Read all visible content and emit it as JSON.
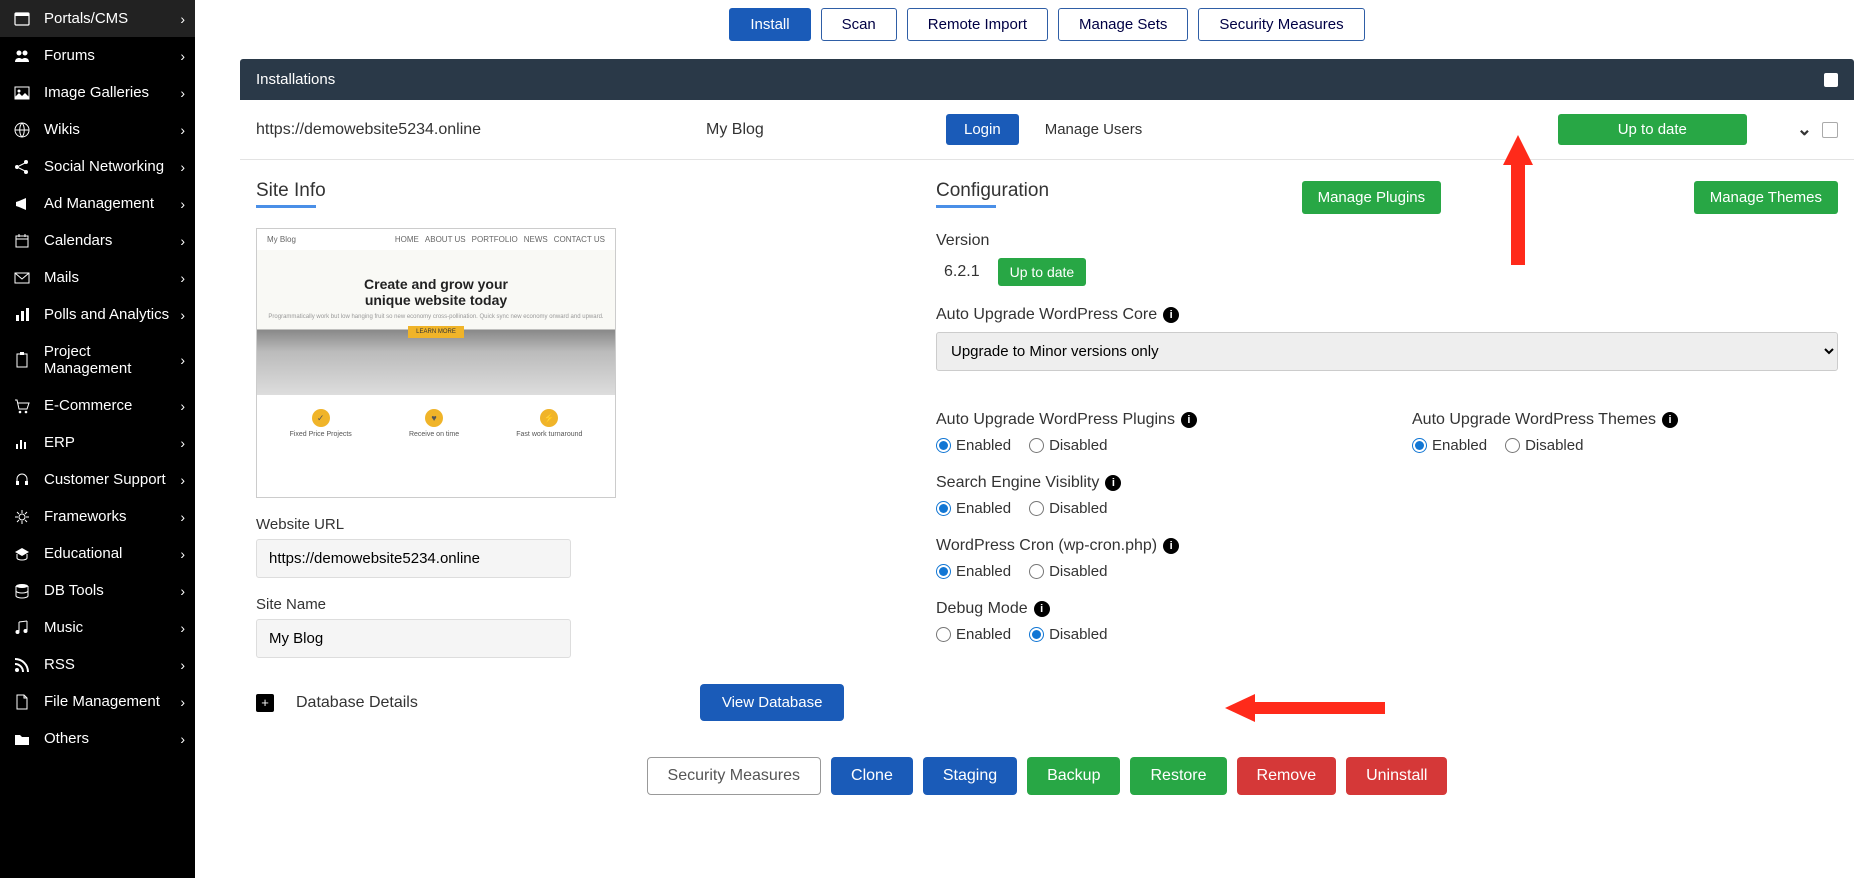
{
  "sidebar": {
    "items": [
      {
        "label": "Portals/CMS"
      },
      {
        "label": "Forums"
      },
      {
        "label": "Image Galleries"
      },
      {
        "label": "Wikis"
      },
      {
        "label": "Social Networking"
      },
      {
        "label": "Ad Management"
      },
      {
        "label": "Calendars"
      },
      {
        "label": "Mails"
      },
      {
        "label": "Polls and Analytics"
      },
      {
        "label": "Project Management"
      },
      {
        "label": "E-Commerce"
      },
      {
        "label": "ERP"
      },
      {
        "label": "Customer Support"
      },
      {
        "label": "Frameworks"
      },
      {
        "label": "Educational"
      },
      {
        "label": "DB Tools"
      },
      {
        "label": "Music"
      },
      {
        "label": "RSS"
      },
      {
        "label": "File Management"
      },
      {
        "label": "Others"
      }
    ]
  },
  "tabs": {
    "install": "Install",
    "scan": "Scan",
    "remote": "Remote Import",
    "sets": "Manage Sets",
    "security": "Security Measures"
  },
  "panel": {
    "title": "Installations"
  },
  "install": {
    "url": "https://demowebsite5234.online",
    "name": "My Blog",
    "login": "Login",
    "manage_users": "Manage Users",
    "status": "Up to date"
  },
  "siteinfo": {
    "title": "Site Info",
    "preview": {
      "brand": "My Blog",
      "nav": [
        "HOME",
        "ABOUT US",
        "PORTFOLIO",
        "NEWS",
        "CONTACT US"
      ],
      "hero1": "Create and grow your",
      "hero2": "unique website today",
      "sub": "Programmatically work but low hanging fruit so new economy cross-pollination. Quick sync new economy onward and upward.",
      "cta": "LEARN MORE",
      "f1": "Fixed Price Projects",
      "f2": "Receive on time",
      "f3": "Fast work turnaround"
    },
    "url_label": "Website URL",
    "url_value": "https://demowebsite5234.online",
    "name_label": "Site Name",
    "name_value": "My Blog",
    "db_details": "Database Details",
    "view_db": "View Database"
  },
  "config": {
    "title": "Configuration",
    "manage_plugins": "Manage Plugins",
    "manage_themes": "Manage Themes",
    "version_label": "Version",
    "version": "6.2.1",
    "version_status": "Up to date",
    "auto_core_label": "Auto Upgrade WordPress Core",
    "auto_core_value": "Upgrade to Minor versions only",
    "auto_plugins_label": "Auto Upgrade WordPress Plugins",
    "auto_themes_label": "Auto Upgrade WordPress Themes",
    "search_label": "Search Engine Visiblity",
    "cron_label": "WordPress Cron (wp-cron.php)",
    "debug_label": "Debug Mode",
    "enabled": "Enabled",
    "disabled": "Disabled"
  },
  "actions": {
    "security": "Security Measures",
    "clone": "Clone",
    "staging": "Staging",
    "backup": "Backup",
    "restore": "Restore",
    "remove": "Remove",
    "uninstall": "Uninstall"
  }
}
